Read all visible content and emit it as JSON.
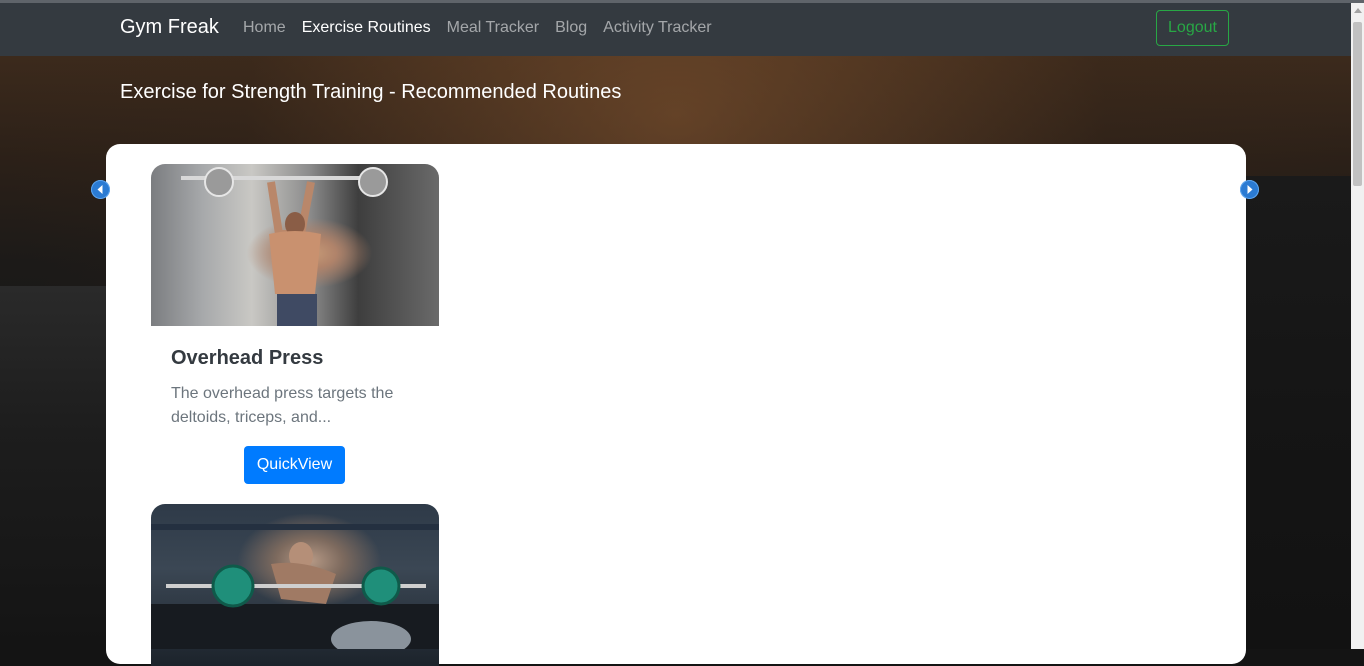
{
  "navbar": {
    "brand": "Gym Freak",
    "links": [
      {
        "label": "Home",
        "active": false
      },
      {
        "label": "Exercise Routines",
        "active": true
      },
      {
        "label": "Meal Tracker",
        "active": false
      },
      {
        "label": "Blog",
        "active": false
      },
      {
        "label": "Activity Tracker",
        "active": false
      }
    ],
    "logout_label": "Logout"
  },
  "page": {
    "title": "Exercise for Strength Training - Recommended Routines"
  },
  "carousel": {
    "prev_icon": "chevron-left-icon",
    "next_icon": "chevron-right-icon"
  },
  "cards": [
    {
      "title": "Overhead Press",
      "description": "The overhead press targets the deltoids, triceps, and...",
      "button_label": "QuickView",
      "image": "man-overhead-barbell-press-image"
    },
    {
      "image": "man-bent-over-barbell-row-image"
    }
  ],
  "colors": {
    "navbar_bg": "#343a40",
    "accent_blue": "#007bff",
    "logout_green": "#28a745"
  }
}
